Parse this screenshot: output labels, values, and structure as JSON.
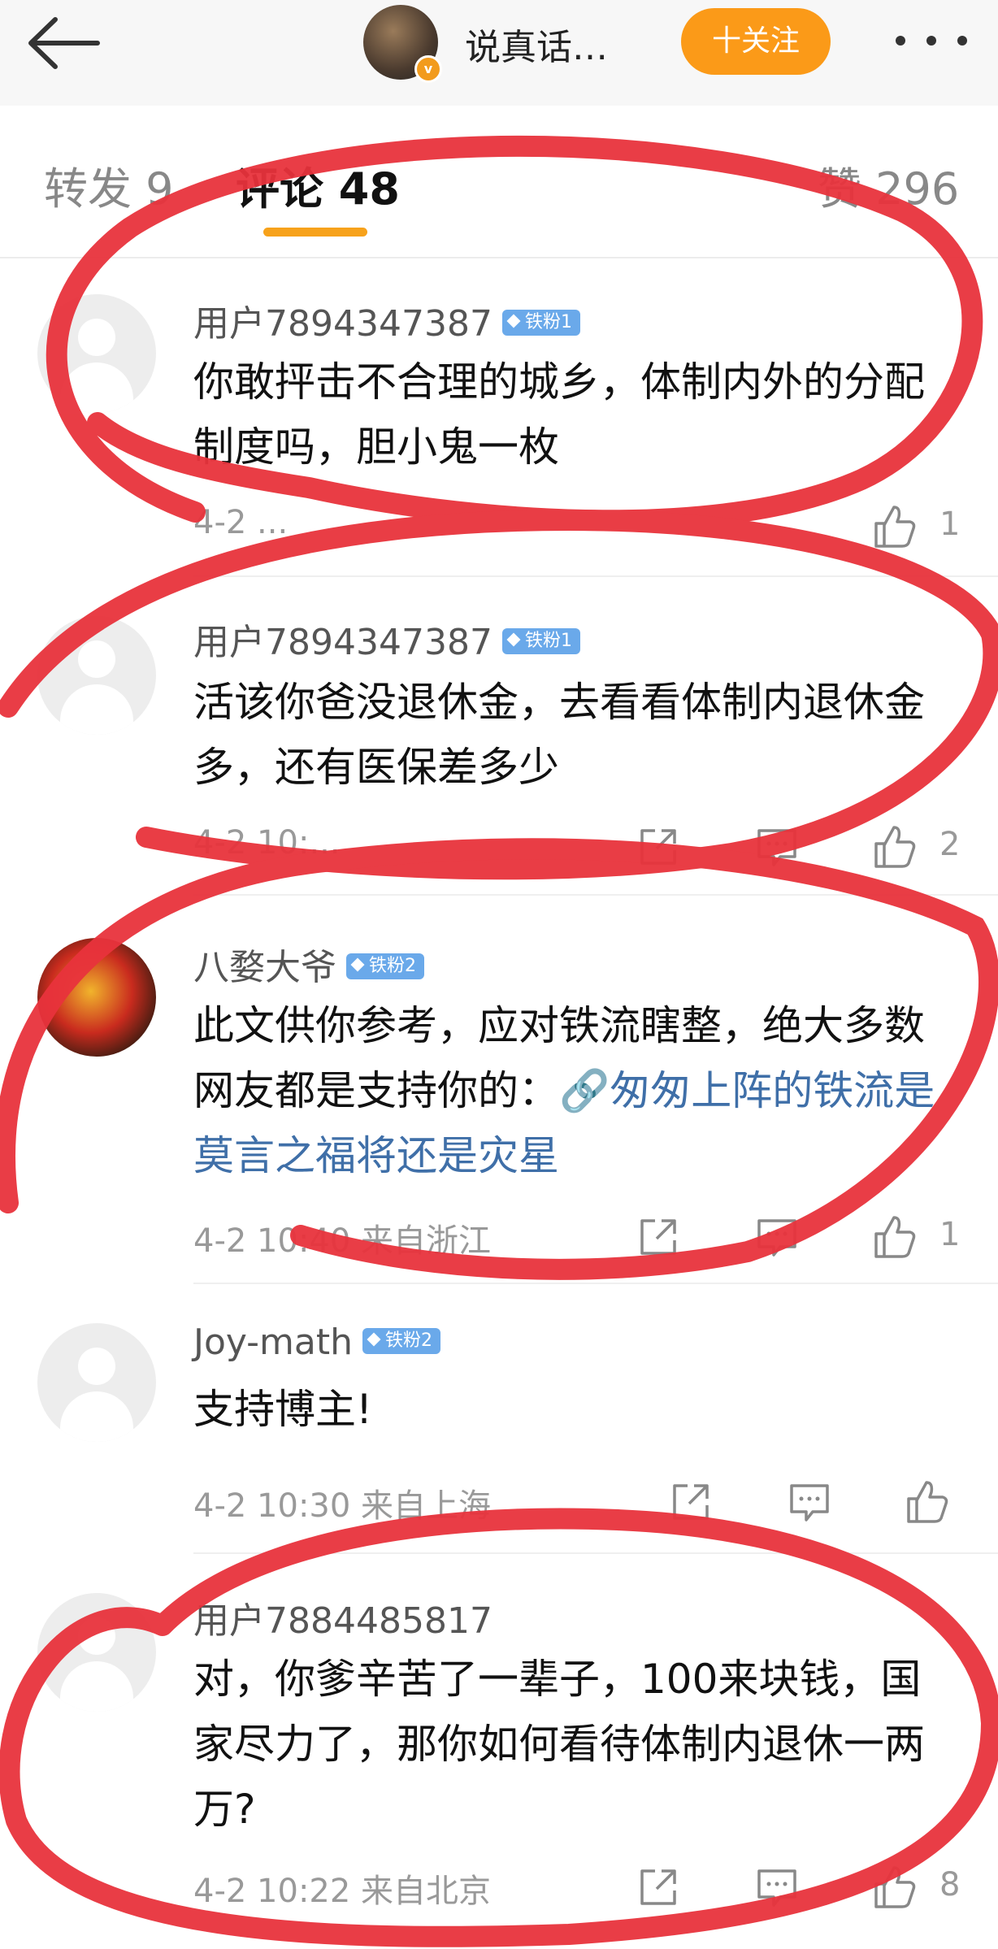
{
  "topbar": {
    "title": "说真话…",
    "follow_label": "十关注",
    "verified_mark": "v"
  },
  "tabs": [
    {
      "label": "转发 9"
    },
    {
      "label": "评论 48"
    },
    {
      "label": "赞 296"
    }
  ],
  "comments": [
    {
      "user": "用户7894347387",
      "badge": "铁粉1",
      "text": "你敢抨击不合理的城乡，体制内外的分配制度吗，胆小鬼一枚",
      "meta": "4-2 ...",
      "likes": "1"
    },
    {
      "user": "用户7894347387",
      "badge": "铁粉1",
      "text": "活该你爸没退休金，去看看体制内退休金多，还有医保差多少",
      "meta": "4-2 10:...",
      "likes": "2"
    },
    {
      "user": "八婺大爷",
      "badge": "铁粉2",
      "text": "此文供你参考，应对铁流瞎整，绝大多数网友都是支持你的：",
      "link": "🔗匆匆上阵的铁流是莫言之福将还是灾星",
      "meta": "4-2 10:40 来自浙江",
      "likes": "1"
    },
    {
      "user": "Joy-math",
      "badge": "铁粉2",
      "text": "支持博主!",
      "meta": "4-2 10:30 来自上海",
      "likes": ""
    },
    {
      "user": "用户7884485817",
      "badge": "",
      "text": "对，你爹辛苦了一辈子，100来块钱，国家尽力了，那你如何看待体制内退休一两万?",
      "meta": "4-2 10:22 来自北京",
      "likes": "8"
    }
  ],
  "colors": {
    "accent": "#fb9a18",
    "tab_underline": "#f7a21b",
    "badge": "#6aa9ea",
    "link": "#3f6fa8",
    "annotation_red": "#e8333c"
  },
  "icons": [
    "back-arrow-icon",
    "more-icon",
    "share-icon",
    "comment-icon",
    "like-icon"
  ]
}
